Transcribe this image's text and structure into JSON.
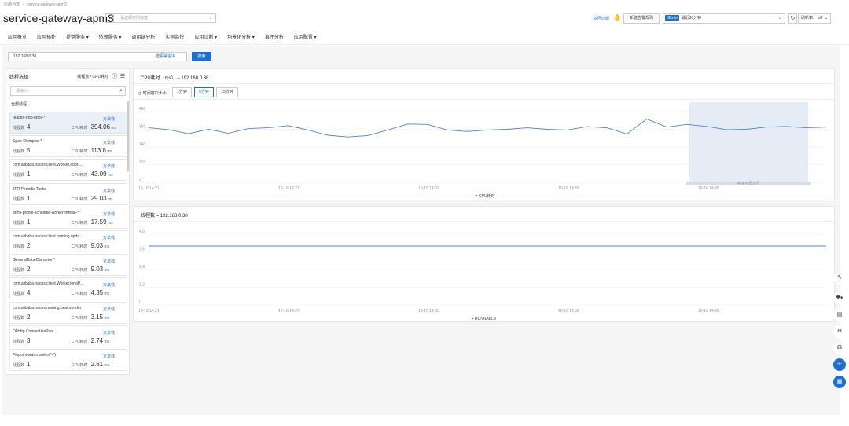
{
  "breadcrumb": [
    "应用列表",
    "service-gateway-apm3"
  ],
  "app": {
    "title": "service-gateway-apm3",
    "select_arrow": "▾",
    "instance_placeholder": "请选择实例标签"
  },
  "header": {
    "link": "返回旧版",
    "alert_button": "新建告警规则",
    "time_badge": "30min",
    "time_label": "最近30分钟",
    "refresh_label": "刷新率:",
    "refresh_value": "off"
  },
  "nav": [
    "应用概览",
    "应用拓扑",
    "提供服务 ▾",
    "依赖服务 ▾",
    "调用链分析",
    "实例监控",
    "应用诊断 ▾",
    "场景化分析 ▾",
    "事件分析",
    "应用配置 ▾"
  ],
  "search": {
    "ip": "192.168.0.38",
    "link": "查看兼容IP",
    "button": "搜索"
  },
  "left_panel": {
    "title": "线程选择",
    "sort_label": "线程数 / CPU耗时",
    "filter_placeholder": "请输入",
    "all_label": "全部线程",
    "count_prefix": "线程数",
    "cpu_prefix": "CPU耗时",
    "link_label": "方法栈",
    "unit": "ms",
    "threads": [
      {
        "name": "reactor-http-epoll-*",
        "count": "4",
        "cpu": "394.06"
      },
      {
        "name": "Span-Disruptor-*",
        "count": "5",
        "cpu": "113.8"
      },
      {
        "name": "com.alibaba.nacos.client.Worker.addr-...",
        "count": "1",
        "cpu": "43.09"
      },
      {
        "name": "JFR Periodic Tasks",
        "count": "1",
        "cpu": "29.03"
      },
      {
        "name": "arms-profile-schedule-worker-thread-*",
        "count": "1",
        "cpu": "17.59"
      },
      {
        "name": "com.alibaba.nacos.client.naming.upda...",
        "count": "2",
        "cpu": "9.03"
      },
      {
        "name": "GeneralData-Disruptor-*",
        "count": "2",
        "cpu": "9.03"
      },
      {
        "name": "com.alibaba.nacos.client.Worker.longP...",
        "count": "4",
        "cpu": "4.35"
      },
      {
        "name": "com.alibaba.nacos.naming.beat.sender",
        "count": "2",
        "cpu": "3.15"
      },
      {
        "name": "OkHttp ConnectionPool",
        "count": "3",
        "cpu": "2.74"
      },
      {
        "name": "Pinpoint-stat-monitor(*-*)",
        "count": "1",
        "cpu": "2.61"
      }
    ]
  },
  "cpu_card": {
    "title": "CPU耗时（ms） – 192.168.0.38",
    "window_label": "时间窗口大小:",
    "segments": [
      "1分钟",
      "5分钟",
      "15分钟"
    ],
    "active_segment": "5分钟",
    "brush_label": "拖拽可框选区",
    "legend": "CPU耗时"
  },
  "threads_card": {
    "title": "线程数 – 192.168.0.38",
    "legend": "RUNNABLE"
  },
  "side_icons": [
    "edit-icon",
    "cart-icon",
    "doc-icon",
    "gear-icon",
    "headset-icon",
    "plane-icon",
    "grid-icon"
  ],
  "chart_data": [
    {
      "type": "line",
      "title": "CPU耗时（ms） – 192.168.0.38",
      "series": [
        {
          "name": "CPU耗时",
          "values": [
            370,
            358,
            330,
            360,
            333,
            365,
            370,
            385,
            355,
            320,
            308,
            318,
            355,
            396,
            393,
            355,
            345,
            355,
            360,
            370,
            360,
            355,
            378,
            370,
            328,
            430,
            375,
            393,
            380,
            358,
            360,
            375,
            380,
            370,
            375
          ]
        }
      ],
      "x_ticks": [
        "10-16 14:21",
        "10-16 14:27",
        "10-16 14:33",
        "10-16 14:39",
        "10-16 14:45"
      ],
      "y_ticks": [
        "0",
        "120",
        "240",
        "360",
        "480"
      ],
      "ylim": [
        0,
        480
      ]
    },
    {
      "type": "line",
      "title": "线程数 – 192.168.0.38",
      "series": [
        {
          "name": "RUNNABLE",
          "values": [
            4,
            4,
            4,
            4,
            4,
            4,
            4,
            4,
            4,
            4,
            4,
            4,
            4,
            4,
            4,
            4,
            4,
            4,
            4,
            4,
            4,
            4,
            4,
            4,
            4,
            4,
            4,
            4,
            4,
            4,
            4,
            4,
            4,
            4,
            4
          ]
        }
      ],
      "x_ticks": [
        "10-16 14:21",
        "10-16 14:27",
        "10-16 14:33",
        "10-16 14:39",
        "10-16 14:45"
      ],
      "y_ticks": [
        "0",
        "1.2",
        "2.4",
        "3.6",
        "4.8"
      ],
      "ylim": [
        0,
        4.8
      ]
    }
  ]
}
